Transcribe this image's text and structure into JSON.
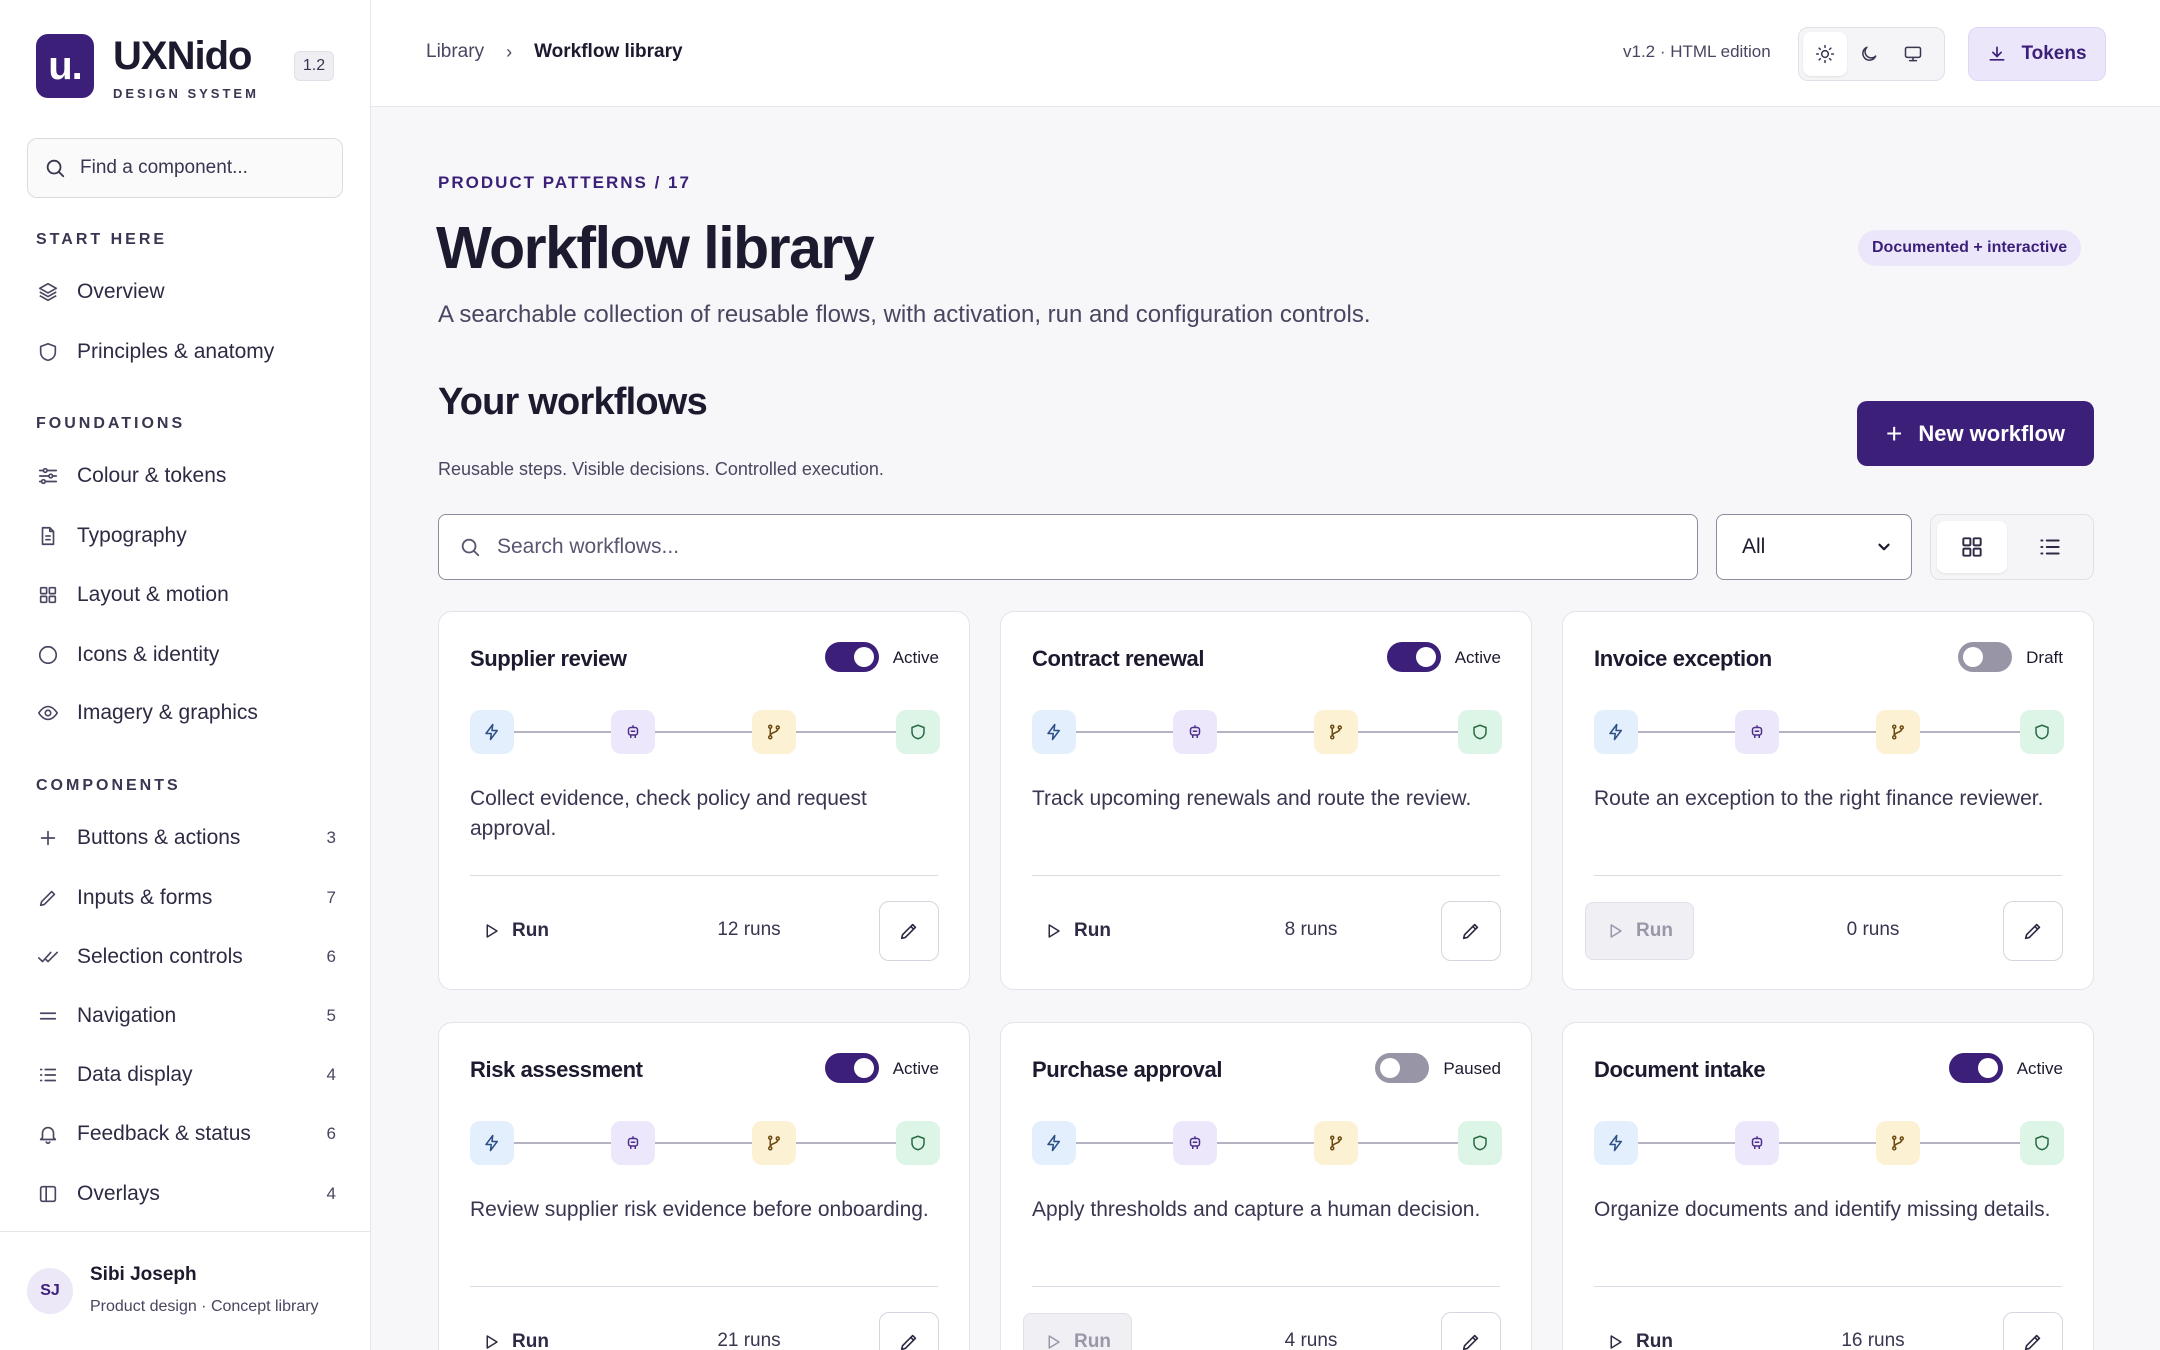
{
  "brand": {
    "logo_text": "u.",
    "name": "UXNido",
    "subtitle": "DESIGN SYSTEM",
    "version": "1.2"
  },
  "sidebar": {
    "search_placeholder": "Find a component...",
    "sections": [
      {
        "title": "START HERE",
        "items": [
          {
            "label": "Overview",
            "icon": "layers-icon"
          },
          {
            "label": "Principles & anatomy",
            "icon": "shield-icon"
          }
        ]
      },
      {
        "title": "FOUNDATIONS",
        "items": [
          {
            "label": "Colour & tokens",
            "icon": "sliders-icon"
          },
          {
            "label": "Typography",
            "icon": "document-icon"
          },
          {
            "label": "Layout & motion",
            "icon": "grid-icon"
          },
          {
            "label": "Icons & identity",
            "icon": "circle-icon"
          },
          {
            "label": "Imagery & graphics",
            "icon": "eye-icon"
          }
        ]
      },
      {
        "title": "COMPONENTS",
        "items": [
          {
            "label": "Buttons & actions",
            "icon": "plus-icon",
            "count": "3"
          },
          {
            "label": "Inputs & forms",
            "icon": "pencil-icon",
            "count": "7"
          },
          {
            "label": "Selection controls",
            "icon": "check-double-icon",
            "count": "6"
          },
          {
            "label": "Navigation",
            "icon": "menu-icon",
            "count": "5"
          },
          {
            "label": "Data display",
            "icon": "list-icon",
            "count": "4"
          },
          {
            "label": "Feedback & status",
            "icon": "bell-icon",
            "count": "6"
          },
          {
            "label": "Overlays",
            "icon": "panel-icon",
            "count": "4"
          }
        ]
      }
    ],
    "user": {
      "initials": "SJ",
      "name": "Sibi Joseph",
      "role": "Product design · Concept library"
    }
  },
  "header": {
    "breadcrumb": [
      "Library",
      "Workflow library"
    ],
    "edition": "v1.2 · HTML edition",
    "theme_modes": [
      "sun-icon",
      "moon-icon",
      "monitor-icon"
    ],
    "active_theme": "sun-icon",
    "tokens_label": "Tokens"
  },
  "main": {
    "eyebrow": "PRODUCT PATTERNS / 17",
    "title": "Workflow library",
    "badge": "Documented + interactive",
    "lede": "A searchable collection of reusable flows, with activation, run and configuration controls.",
    "section_title": "Your workflows",
    "section_sub": "Reusable steps. Visible decisions. Controlled execution.",
    "new_label": "New workflow",
    "search_placeholder": "Search workflows...",
    "filter_value": "All",
    "view_modes": [
      "grid-view-icon",
      "list-view-icon"
    ],
    "active_view": "grid-view-icon",
    "step_icons": [
      "bolt-icon",
      "robot-icon",
      "branch-icon",
      "shield-check-icon"
    ],
    "accent": "#3b1f78"
  },
  "workflows": [
    {
      "title": "Supplier review",
      "status": "Active",
      "enabled": true,
      "desc": "Collect evidence, check policy and request approval.",
      "run_label": "Run",
      "runs": "12 runs",
      "run_disabled": false
    },
    {
      "title": "Contract renewal",
      "status": "Active",
      "enabled": true,
      "desc": "Track upcoming renewals and route the review.",
      "run_label": "Run",
      "runs": "8 runs",
      "run_disabled": false
    },
    {
      "title": "Invoice exception",
      "status": "Draft",
      "enabled": false,
      "desc": "Route an exception to the right finance reviewer.",
      "run_label": "Run",
      "runs": "0 runs",
      "run_disabled": true
    },
    {
      "title": "Risk assessment",
      "status": "Active",
      "enabled": true,
      "desc": "Review supplier risk evidence before onboarding.",
      "run_label": "Run",
      "runs": "21 runs",
      "run_disabled": false
    },
    {
      "title": "Purchase approval",
      "status": "Paused",
      "enabled": false,
      "desc": "Apply thresholds and capture a human decision.",
      "run_label": "Run",
      "runs": "4 runs",
      "run_disabled": true
    },
    {
      "title": "Document intake",
      "status": "Active",
      "enabled": true,
      "desc": "Organize documents and identify missing details.",
      "run_label": "Run",
      "runs": "16 runs",
      "run_disabled": false
    }
  ]
}
